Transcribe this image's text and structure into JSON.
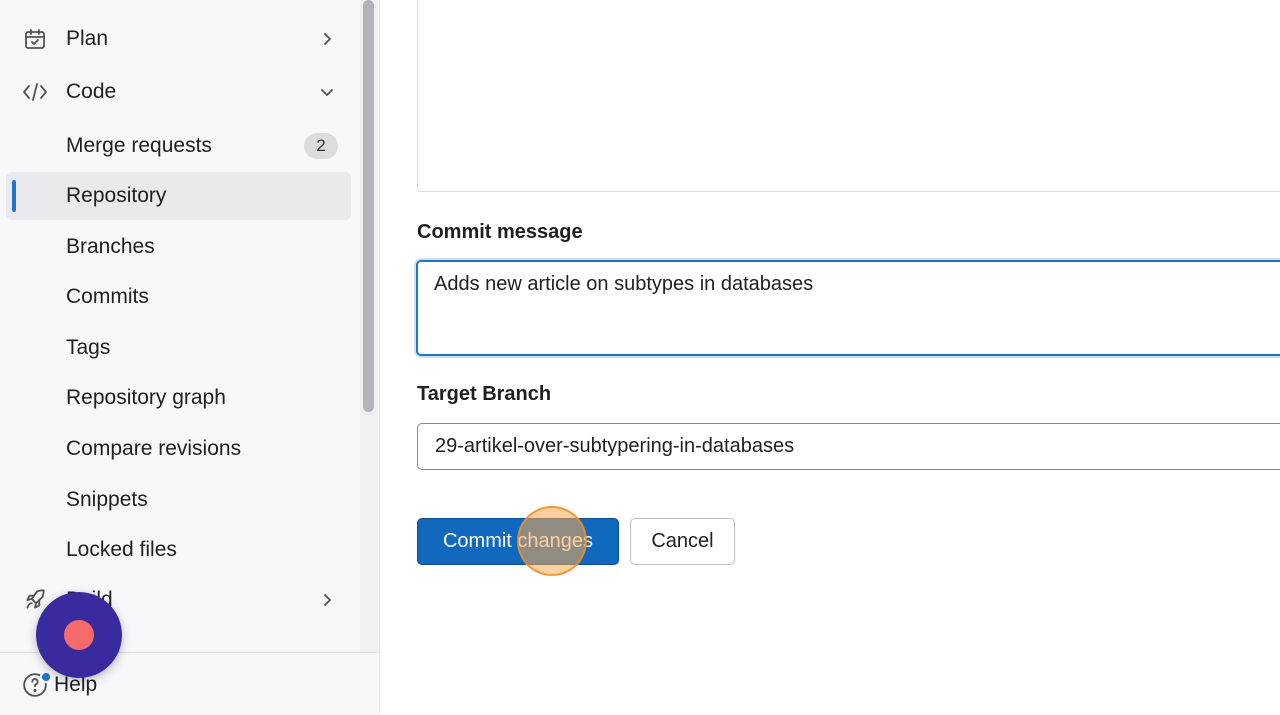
{
  "sidebar": {
    "plan_label": "Plan",
    "code_label": "Code",
    "code_items": [
      {
        "label": "Merge requests",
        "badge": "2"
      },
      {
        "label": "Repository"
      },
      {
        "label": "Branches"
      },
      {
        "label": "Commits"
      },
      {
        "label": "Tags"
      },
      {
        "label": "Repository graph"
      },
      {
        "label": "Compare revisions"
      },
      {
        "label": "Snippets"
      },
      {
        "label": "Locked files"
      }
    ],
    "build_label": "Build",
    "help_label": "Help"
  },
  "form": {
    "commit_message_label": "Commit message",
    "commit_message_value": "Adds new article on subtypes in databases",
    "target_branch_label": "Target Branch",
    "target_branch_value": "29-artikel-over-subtypering-in-databases",
    "commit_button": "Commit changes",
    "cancel_button": "Cancel"
  },
  "colors": {
    "accent": "#1f75cb",
    "primary_button": "#1068bf",
    "record_button": "#3a2aa0",
    "record_dot": "#f76b6b",
    "click_marker": "#faaa50"
  },
  "icons": [
    "calendar-icon",
    "code-icon",
    "chevron-right-icon",
    "chevron-down-icon",
    "rocket-icon",
    "help-icon",
    "record-icon"
  ]
}
